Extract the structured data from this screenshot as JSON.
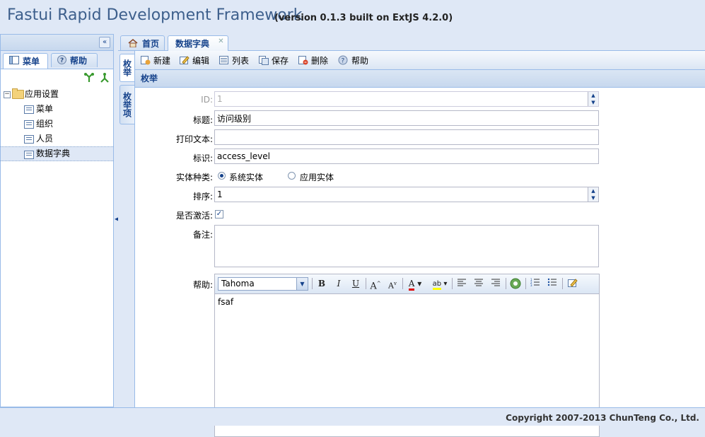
{
  "header": {
    "title": "Fastui Rapid Development Framework",
    "version": "(version 0.1.3 built on ExtJS 4.2.0)"
  },
  "west": {
    "tabs": [
      {
        "label": "菜单",
        "icon": "menu-icon"
      },
      {
        "label": "帮助",
        "icon": "help-icon"
      }
    ],
    "active_tab": 0,
    "tools": [
      "expand-all-icon",
      "collapse-all-icon"
    ],
    "tree": {
      "root": "应用设置",
      "children": [
        "菜单",
        "组织",
        "人员",
        "数据字典"
      ],
      "selected": "数据字典"
    }
  },
  "center": {
    "tabs": [
      {
        "label": "首页",
        "icon": "home-icon"
      },
      {
        "label": "数据字典",
        "closable": true
      }
    ],
    "active_tab": 1,
    "vertical_tabs": [
      "枚举",
      "枚举项"
    ],
    "active_vertical_tab": 0,
    "toolbar": [
      {
        "label": "新建",
        "icon": "new-icon"
      },
      {
        "label": "编辑",
        "icon": "edit-icon"
      },
      {
        "label": "列表",
        "icon": "list-icon"
      },
      {
        "label": "保存",
        "icon": "save-icon"
      },
      {
        "label": "删除",
        "icon": "delete-icon"
      },
      {
        "label": "帮助",
        "icon": "help-icon"
      }
    ],
    "form_title": "枚举",
    "form": {
      "id": {
        "label": "ID:",
        "value": "1"
      },
      "title": {
        "label": "标题:",
        "value": "访问级别"
      },
      "print_text": {
        "label": "打印文本:",
        "value": ""
      },
      "identifier": {
        "label": "标识:",
        "value": "access_level"
      },
      "entity_type": {
        "label": "实体种类:",
        "options": [
          "系统实体",
          "应用实体"
        ],
        "selected": "系统实体"
      },
      "order": {
        "label": "排序:",
        "value": "1"
      },
      "active": {
        "label": "是否激活:",
        "checked": true
      },
      "remark": {
        "label": "备注:",
        "value": ""
      },
      "help": {
        "label": "帮助:",
        "font": "Tahoma",
        "content": "fsaf"
      }
    }
  },
  "footer": {
    "copyright": "Copyright 2007-2013 ChunTeng Co., Ltd."
  },
  "colors": {
    "accent": "#15428b",
    "border": "#99bbe8",
    "background": "#dfe8f6"
  }
}
